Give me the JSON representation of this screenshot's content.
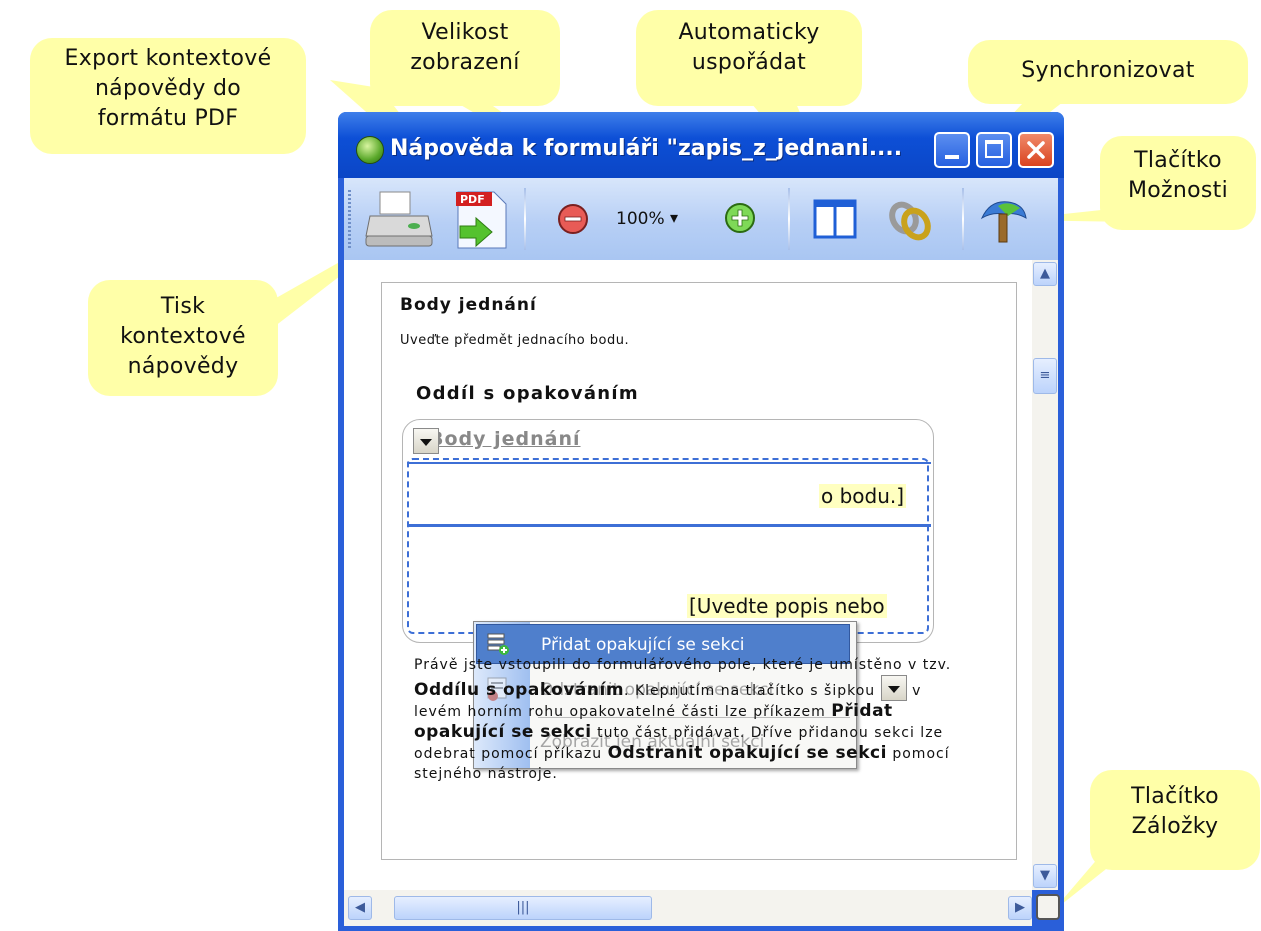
{
  "callouts": {
    "export": "Export kontextové\nnápovědy do\nformátu PDF",
    "zoom": "Velikost\nzobrazení",
    "auto_arrange": "Automaticky\nuspořádat",
    "sync": "Synchronizovat",
    "options": "Tlačítko\nMožnosti",
    "print": "Tisk\nkontextové\nnápovědy",
    "bookmarks": "Tlačítko\nZáložky"
  },
  "window": {
    "title": "Nápověda k formuláři \"zapis_z_jednani...."
  },
  "toolbar": {
    "pdf_label": "PDF",
    "zoom_value": "100%",
    "zoom_arrow": "▾",
    "zoom_out_icon": "minus-circle-icon",
    "zoom_in_icon": "plus-circle-icon"
  },
  "content": {
    "heading": "Body jednání",
    "subheading": "Uveďte předmět jednacího bodu.",
    "section_title": "Oddíl s opakováním",
    "repeating_header": "Body jednání",
    "placeholder_1": "o bodu.]",
    "placeholder_2": "[Uvedte popis nebo",
    "paragraph": {
      "p1": "Právě jste vstoupili do formulářového pole, které je umístěno v tzv.",
      "b1": "Oddílu s opakováním",
      "p2": ". Klepnutím na tlačítko s šipkou",
      "p3": "v levém horním rohu opakovatelné části lze příkazem",
      "b2": "Přidat opakující se sekci",
      "p4": "tuto část přidávat. Dříve přidanou sekci lze odebrat pomocí příkazu",
      "b3": "Odstranit opakující se sekci",
      "p5": "pomocí stejného nástroje."
    }
  },
  "menu": {
    "items": [
      {
        "label": "Přidat opakující se sekci",
        "state": "highlighted"
      },
      {
        "label": "Odstranit opakující se sekci",
        "state": "disabled"
      },
      {
        "label": "Zobrazit jen aktuální sekci",
        "state": "disabled"
      }
    ]
  },
  "colors": {
    "callout_bg": "#ffffa8",
    "title_bar": "#0b46c6",
    "menu_highlight": "#4f7fcc",
    "placeholder_bg": "#ffffc0"
  }
}
